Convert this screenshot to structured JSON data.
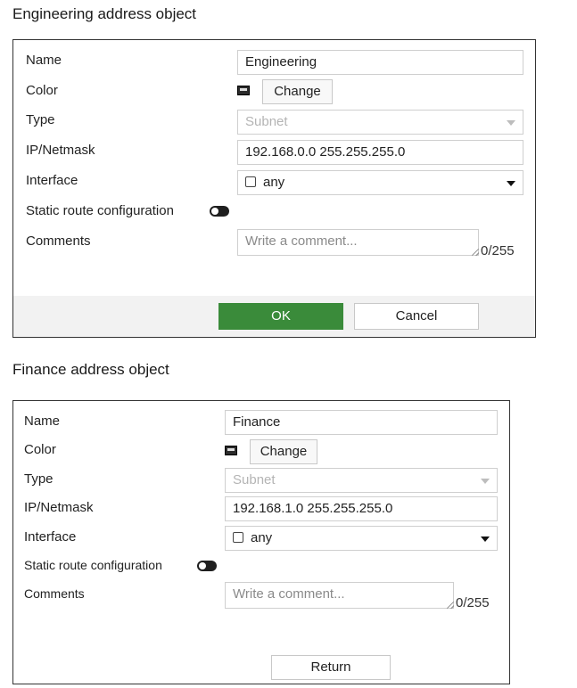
{
  "engineering": {
    "title": "Engineering address object",
    "labels": {
      "name": "Name",
      "color": "Color",
      "type": "Type",
      "ip_netmask": "IP/Netmask",
      "interface": "Interface",
      "static_route": "Static route configuration",
      "comments": "Comments"
    },
    "name_value": "Engineering",
    "color_button": "Change",
    "type_value": "Subnet",
    "ip_value": "192.168.0.0 255.255.255.0",
    "interface_value": "any",
    "static_route_enabled": false,
    "comment_placeholder": "Write a comment...",
    "comment_counter": "0/255",
    "ok_label": "OK",
    "cancel_label": "Cancel"
  },
  "finance": {
    "title": "Finance address object",
    "labels": {
      "name": "Name",
      "color": "Color",
      "type": "Type",
      "ip_netmask": "IP/Netmask",
      "interface": "Interface",
      "static_route": "Static route configuration",
      "comments": "Comments"
    },
    "name_value": "Finance",
    "color_button": "Change",
    "type_value": "Subnet",
    "ip_value": "192.168.1.0 255.255.255.0",
    "interface_value": "any",
    "static_route_enabled": false,
    "comment_placeholder": "Write a comment...",
    "comment_counter": "0/255",
    "return_label": "Return"
  },
  "icons": {
    "color_swatch": "color-swatch-icon",
    "dropdown": "chevron-down-icon",
    "interface": "checkbox-icon",
    "toggle": "toggle-switch-icon",
    "resize": "resize-handle-icon"
  }
}
